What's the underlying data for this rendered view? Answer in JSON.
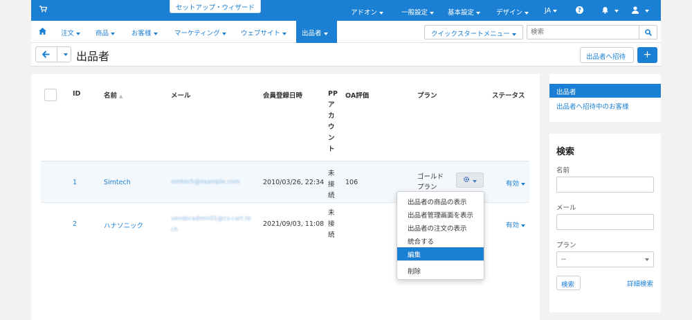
{
  "topbar": {
    "wizard": "セットアップ・ウィザード",
    "menus": [
      "アドオン",
      "一般設定",
      "基本設定",
      "デザイン",
      "JA"
    ]
  },
  "nav": {
    "items": [
      "注文",
      "商品",
      "お客様",
      "マーケティング",
      "ウェブサイト"
    ],
    "active": "出品者",
    "quickstart": "クイックスタートメニュー",
    "search_placeholder": "検索"
  },
  "titlebar": {
    "title": "出品者",
    "invite": "出品者へ招待"
  },
  "table": {
    "headers": {
      "id": "ID",
      "name": "名前",
      "email": "メール",
      "registered": "会員登録日時",
      "pp_chars": [
        "PP",
        "ア",
        "カ",
        "ウ",
        "ン",
        "ト"
      ],
      "oa": "OA評価",
      "plan": "プラン",
      "status": "ステータス"
    },
    "rows": [
      {
        "id": "1",
        "name": "Simtech",
        "email": "simtech@example.com",
        "registered": "2010/03/26, 22:34",
        "pp_chars": [
          "未",
          "接",
          "続"
        ],
        "oa": "106",
        "plan_lines": [
          "ゴールド",
          "プラン"
        ],
        "status": "有効"
      },
      {
        "id": "2",
        "name": "ハナソニック",
        "email_lines": [
          "vendoradmin01@cs-cart.te",
          "ch"
        ],
        "registered": "2021/09/03, 11:08",
        "pp_chars": [
          "未",
          "接",
          "続"
        ],
        "status": "有効"
      }
    ]
  },
  "dropdown": {
    "items": [
      "出品者の商品の表示",
      "出品者管理画面を表示",
      "出品者の注文の表示",
      "統合する",
      "編集",
      "削除"
    ]
  },
  "sidebar": {
    "items": [
      "出品者",
      "出品者へ招待中のお客様"
    ],
    "search_title": "検索",
    "labels": {
      "name": "名前",
      "email": "メール",
      "plan": "プラン"
    },
    "plan_value": "--",
    "search_button": "検索",
    "advanced": "詳細検索"
  }
}
